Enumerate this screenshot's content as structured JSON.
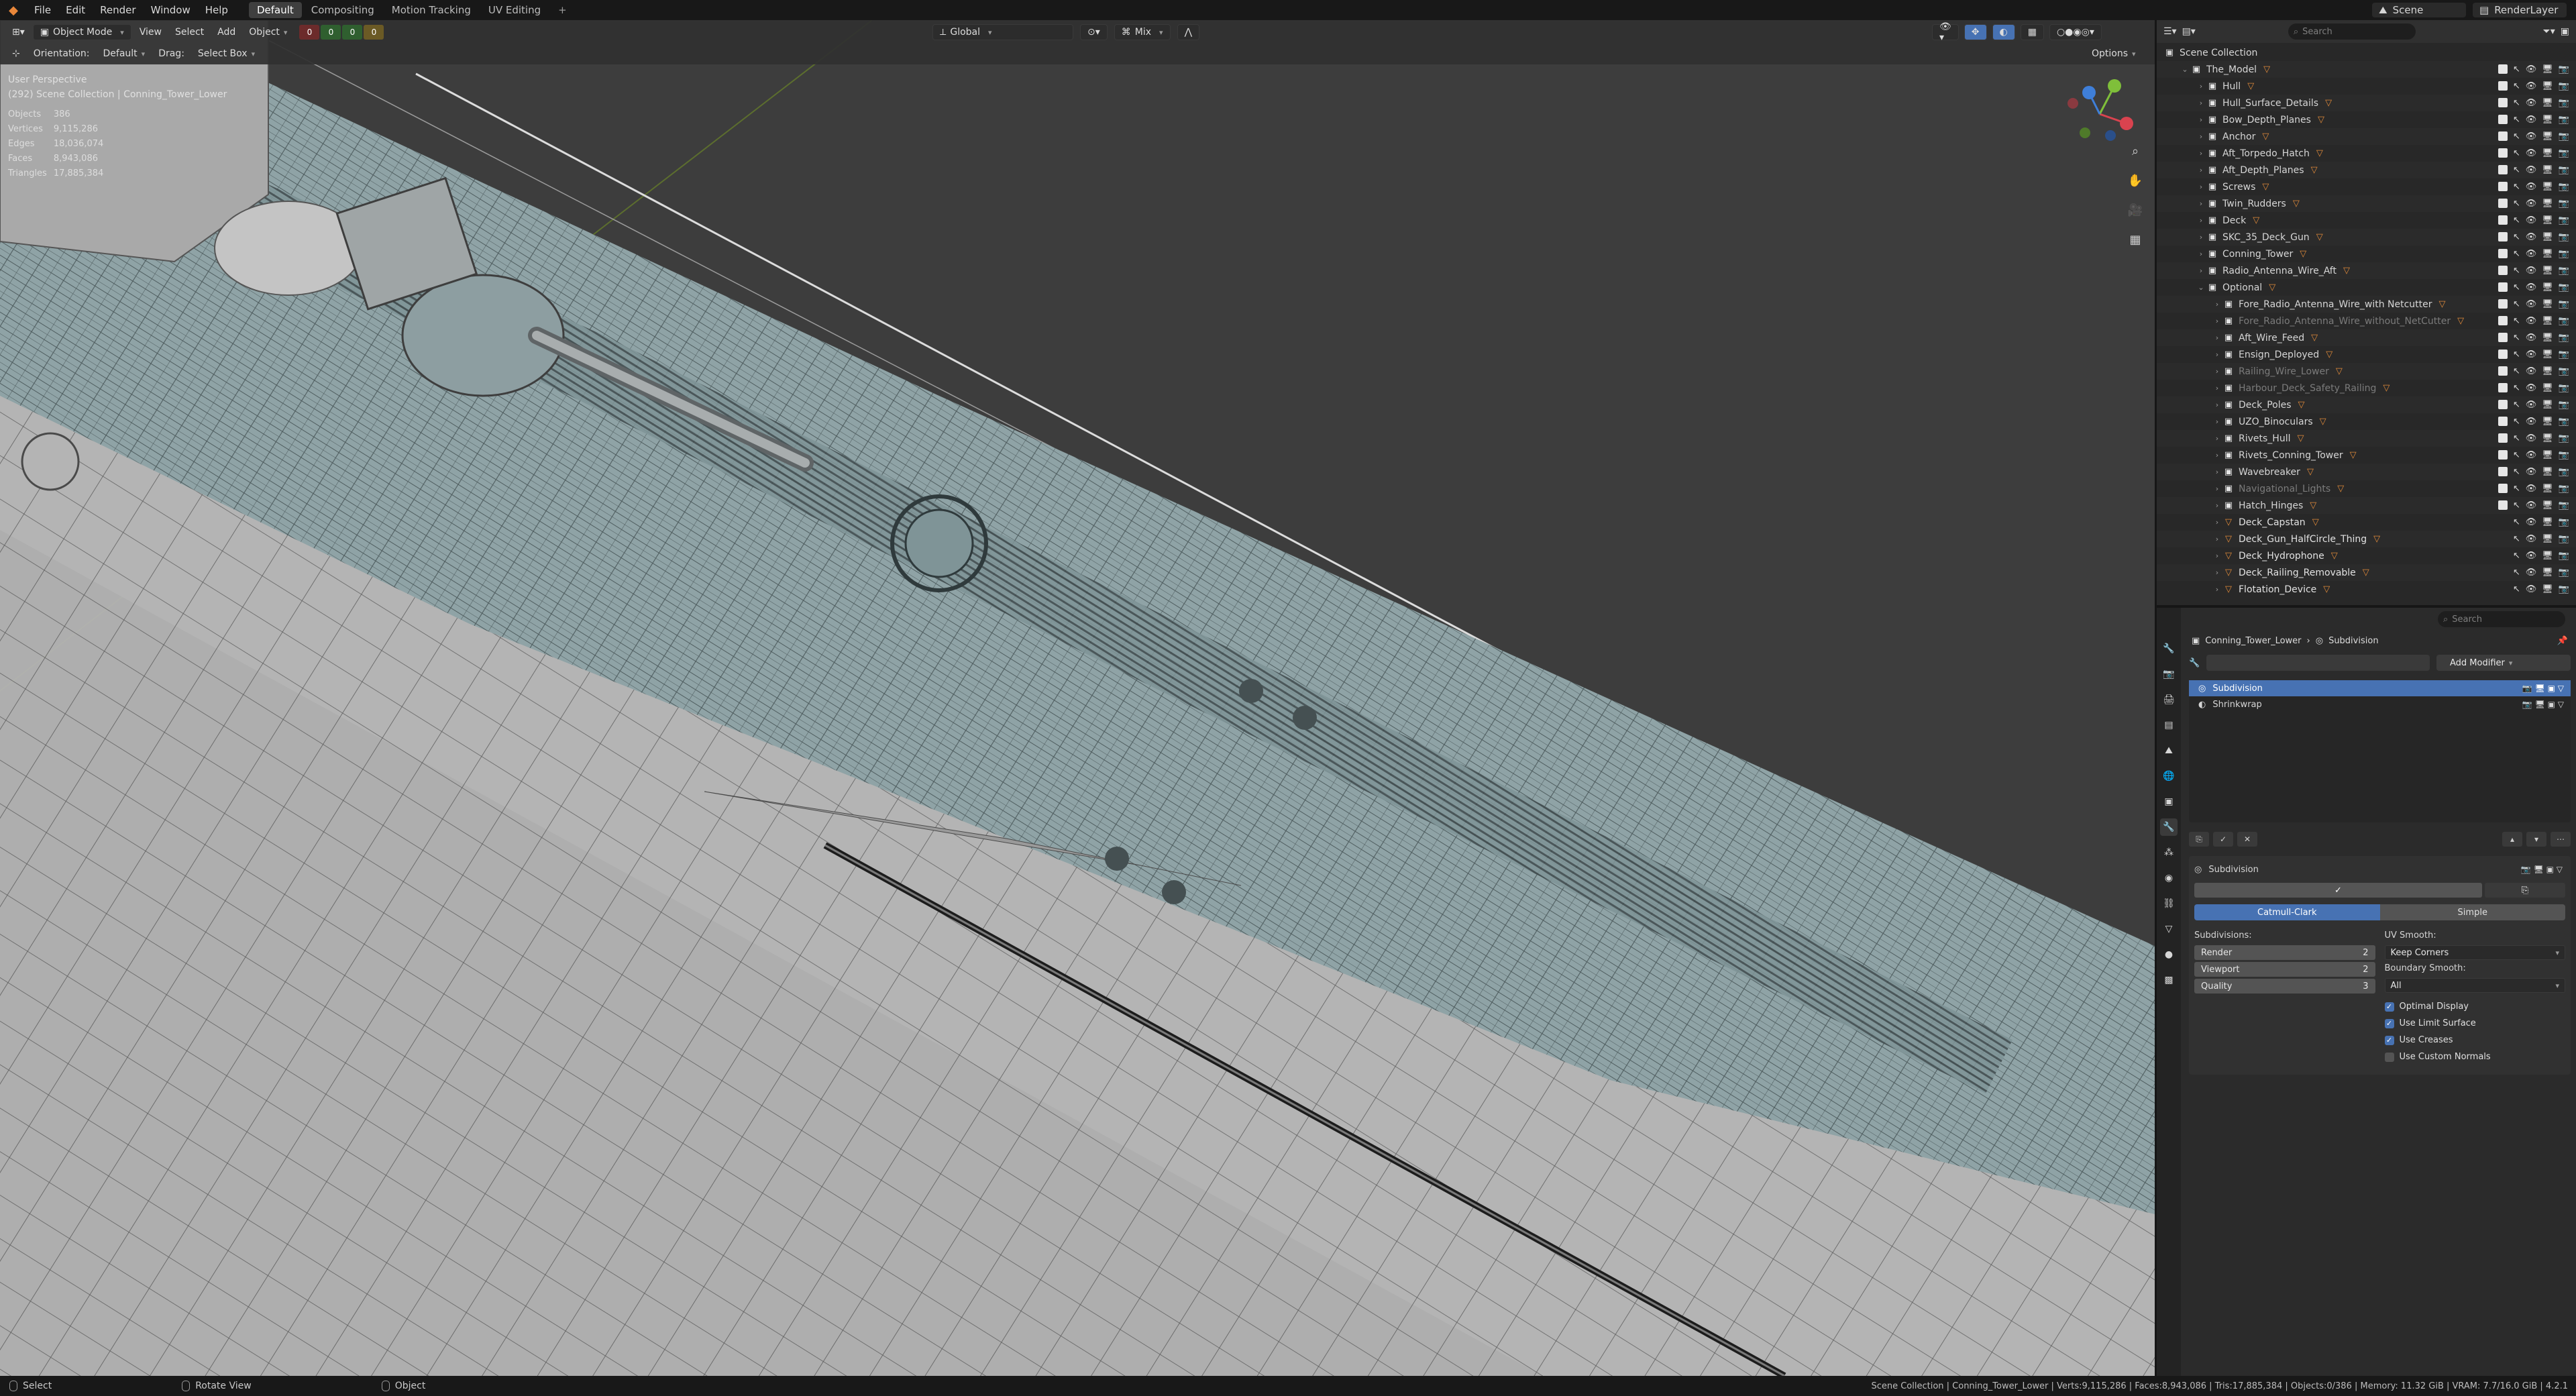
{
  "menu": {
    "items": [
      "File",
      "Edit",
      "Render",
      "Window",
      "Help"
    ],
    "workspaces": [
      "Default",
      "Compositing",
      "Motion Tracking",
      "UV Editing"
    ],
    "active_workspace": "Default",
    "scene": "Scene",
    "view_layer": "RenderLayer"
  },
  "header": {
    "mode": "Object Mode",
    "view": "View",
    "select": "Select",
    "add": "Add",
    "object": "Object",
    "orientation_label": "Orientation:",
    "orientation_value": "Default",
    "drag_label": "Drag:",
    "drag_value": "Select Box",
    "transform": "Global",
    "snap_mix": "Mix",
    "options": "Options",
    "layer_counts": [
      "0",
      "0",
      "0",
      "0"
    ]
  },
  "viewport": {
    "view_name": "User Perspective",
    "collection_path": "(292) Scene Collection | Conning_Tower_Lower",
    "stats": [
      {
        "label": "Objects",
        "value": "386"
      },
      {
        "label": "Vertices",
        "value": "9,115,286"
      },
      {
        "label": "Edges",
        "value": "18,036,074"
      },
      {
        "label": "Faces",
        "value": "8,943,086"
      },
      {
        "label": "Triangles",
        "value": "17,885,384"
      }
    ],
    "gizmo_axes": [
      "X",
      "Y",
      "Z"
    ]
  },
  "outliner": {
    "search_placeholder": "Search",
    "root": "Scene Collection",
    "items": [
      {
        "name": "The_Model",
        "level": 1,
        "type": "collection",
        "open": true
      },
      {
        "name": "Hull",
        "level": 2,
        "type": "collection"
      },
      {
        "name": "Hull_Surface_Details",
        "level": 2,
        "type": "collection"
      },
      {
        "name": "Bow_Depth_Planes",
        "level": 2,
        "type": "collection"
      },
      {
        "name": "Anchor",
        "level": 2,
        "type": "collection"
      },
      {
        "name": "Aft_Torpedo_Hatch",
        "level": 2,
        "type": "collection"
      },
      {
        "name": "Aft_Depth_Planes",
        "level": 2,
        "type": "collection"
      },
      {
        "name": "Screws",
        "level": 2,
        "type": "collection"
      },
      {
        "name": "Twin_Rudders",
        "level": 2,
        "type": "collection"
      },
      {
        "name": "Deck",
        "level": 2,
        "type": "collection"
      },
      {
        "name": "SKC_35_Deck_Gun",
        "level": 2,
        "type": "collection"
      },
      {
        "name": "Conning_Tower",
        "level": 2,
        "type": "collection"
      },
      {
        "name": "Radio_Antenna_Wire_Aft",
        "level": 2,
        "type": "collection"
      },
      {
        "name": "Optional",
        "level": 2,
        "type": "collection",
        "open": true
      },
      {
        "name": "Fore_Radio_Antenna_Wire_with Netcutter",
        "level": 3,
        "type": "collection"
      },
      {
        "name": "Fore_Radio_Antenna_Wire_without_NetCutter",
        "level": 3,
        "type": "collection",
        "dim": true
      },
      {
        "name": "Aft_Wire_Feed",
        "level": 3,
        "type": "collection"
      },
      {
        "name": "Ensign_Deployed",
        "level": 3,
        "type": "collection"
      },
      {
        "name": "Railing_Wire_Lower",
        "level": 3,
        "type": "collection",
        "dim": true
      },
      {
        "name": "Harbour_Deck_Safety_Railing",
        "level": 3,
        "type": "collection",
        "dim": true
      },
      {
        "name": "Deck_Poles",
        "level": 3,
        "type": "collection"
      },
      {
        "name": "UZO_Binoculars",
        "level": 3,
        "type": "collection"
      },
      {
        "name": "Rivets_Hull",
        "level": 3,
        "type": "collection"
      },
      {
        "name": "Rivets_Conning_Tower",
        "level": 3,
        "type": "collection"
      },
      {
        "name": "Wavebreaker",
        "level": 3,
        "type": "collection"
      },
      {
        "name": "Navigational_Lights",
        "level": 3,
        "type": "collection",
        "dim": true
      },
      {
        "name": "Hatch_Hinges",
        "level": 3,
        "type": "collection"
      },
      {
        "name": "Deck_Capstan",
        "level": 3,
        "type": "object",
        "dim": true
      },
      {
        "name": "Deck_Gun_HalfCircle_Thing",
        "level": 3,
        "type": "object"
      },
      {
        "name": "Deck_Hydrophone",
        "level": 3,
        "type": "object"
      },
      {
        "name": "Deck_Railing_Removable",
        "level": 3,
        "type": "object"
      },
      {
        "name": "Flotation_Device",
        "level": 3,
        "type": "object"
      }
    ]
  },
  "properties": {
    "search_placeholder": "Search",
    "breadcrumb_object": "Conning_Tower_Lower",
    "breadcrumb_modifier": "Subdivision",
    "add_modifier": "Add Modifier",
    "modifiers": [
      "Subdivision",
      "Shrinkwrap"
    ],
    "selected_modifier": "Subdivision",
    "panel_name": "Subdivision",
    "algo_options": [
      "Catmull-Clark",
      "Simple"
    ],
    "algo_selected": "Catmull-Clark",
    "subdivisions_label": "Subdivisions:",
    "render_label": "Render",
    "render_value": "2",
    "viewport_label": "Viewport",
    "viewport_value": "2",
    "quality_label": "Quality",
    "quality_value": "3",
    "uv_smooth_label": "UV Smooth:",
    "uv_smooth_value": "Keep Corners",
    "boundary_label": "Boundary Smooth:",
    "boundary_value": "All",
    "checks": [
      {
        "label": "Optimal Display",
        "checked": true
      },
      {
        "label": "Use Limit Surface",
        "checked": true
      },
      {
        "label": "Use Creases",
        "checked": true
      },
      {
        "label": "Use Custom Normals",
        "checked": false
      }
    ]
  },
  "status": {
    "select": "Select",
    "rotate": "Rotate View",
    "object": "Object",
    "info": "Scene Collection | Conning_Tower_Lower | Verts:9,115,286 | Faces:8,943,086 | Tris:17,885,384 | Objects:0/386 | Memory: 11.32 GiB | VRAM: 7.7/16.0 GiB | 4.2.1"
  },
  "colors": {
    "accent": "#4772b3",
    "orange": "#e08a3a",
    "hull": "#b9b9b9",
    "deck": "#8ea2a6",
    "grid_line": "#6b7d3a"
  }
}
